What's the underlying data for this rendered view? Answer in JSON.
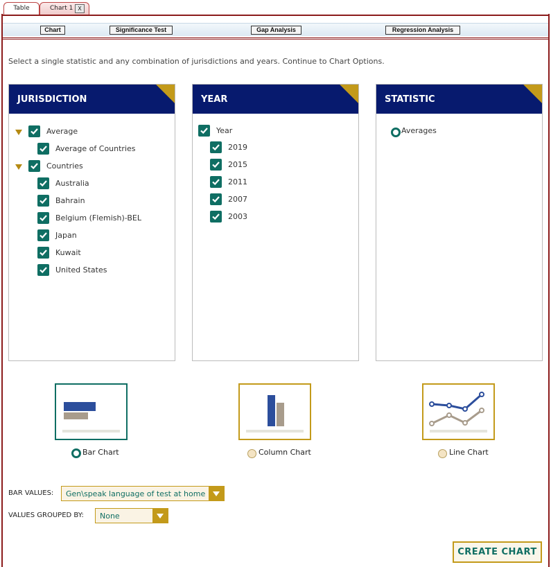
{
  "tabs": [
    {
      "label": "Table"
    },
    {
      "label": "Chart 1",
      "close": "X"
    }
  ],
  "toolbar": {
    "chart": "Chart",
    "significance": "Significance Test",
    "gap": "Gap Analysis",
    "regression": "Regression Analysis"
  },
  "instructions": "Select a single statistic and any combination of jurisdictions and years. Continue to Chart Options.",
  "jurisdiction": {
    "title": "JURISDICTION",
    "average_group": "Average",
    "average_items": [
      "Average of Countries"
    ],
    "countries_group": "Countries",
    "countries": [
      "Australia",
      "Bahrain",
      "Belgium (Flemish)-BEL",
      "Japan",
      "Kuwait",
      "United States"
    ]
  },
  "year": {
    "title": "YEAR",
    "group": "Year",
    "items": [
      "2019",
      "2015",
      "2011",
      "2007",
      "2003"
    ]
  },
  "statistic": {
    "title": "STATISTIC",
    "selected": "Averages"
  },
  "chart_types": {
    "bar": "Bar Chart",
    "column": "Column Chart",
    "line": "Line Chart",
    "selected": "bar"
  },
  "form": {
    "bar_values_label": "BAR VALUES:",
    "bar_values_value": "Gen\\speak language of test at home",
    "grouped_label": "VALUES GROUPED BY:",
    "grouped_value": "None"
  },
  "create_button": "CREATE CHART",
  "colors": {
    "navy": "#071a6e",
    "gold": "#c39a1a",
    "teal": "#0f6e63",
    "maroon": "#8b1a1a"
  }
}
